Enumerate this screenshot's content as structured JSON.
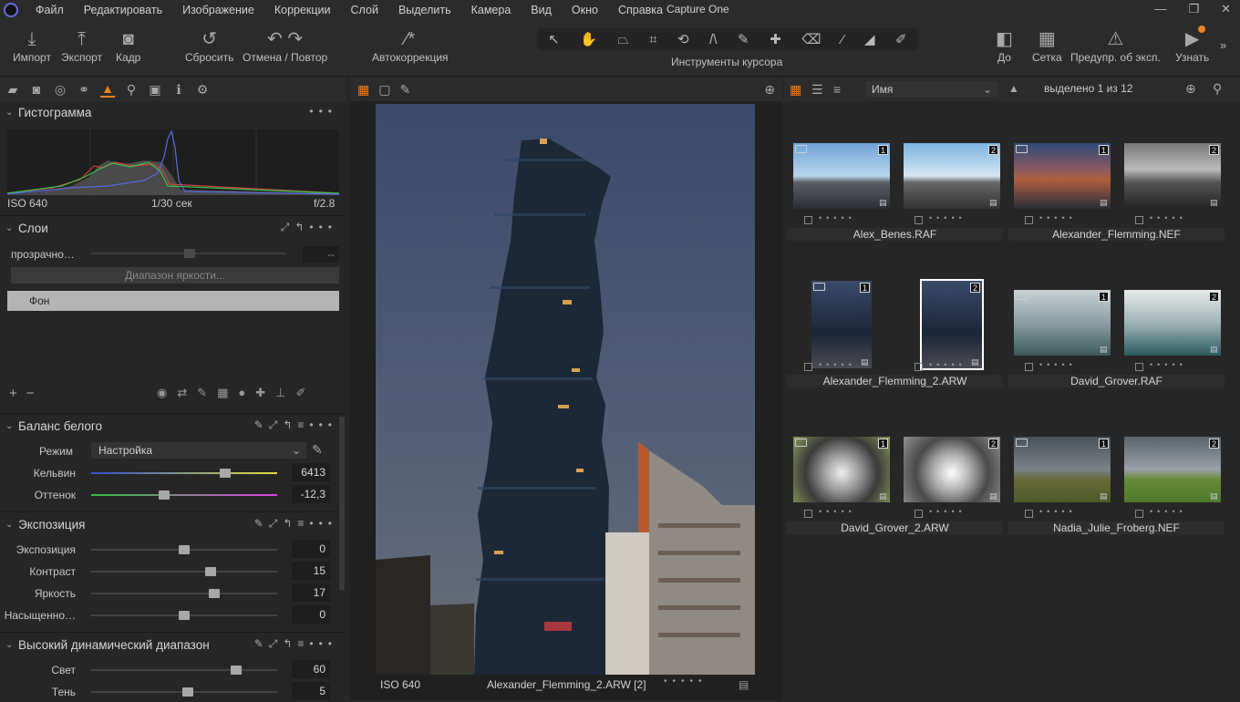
{
  "menu": {
    "items": [
      "Файл",
      "Редактировать",
      "Изображение",
      "Коррекции",
      "Слой",
      "Выделить",
      "Камера",
      "Вид",
      "Окно",
      "Справка"
    ],
    "app_title": "Capture One"
  },
  "toolbar": {
    "import": "Импорт",
    "export": "Экспорт",
    "crop": "Кадр",
    "reset": "Сбросить",
    "undo_redo": "Отмена / Повтор",
    "autocorrect": "Автокоррекция",
    "cursor_tools": "Инструменты курсора",
    "before": "До",
    "grid": "Сетка",
    "exposure_warning": "Предупр. об эксп.",
    "learn": "Узнать"
  },
  "histogram": {
    "title": "Гистограмма",
    "iso": "ISO 640",
    "shutter": "1/30 сек",
    "aperture": "f/2.8"
  },
  "layers": {
    "title": "Слои",
    "opacity_label": "прозрачно…",
    "opacity_value": "--",
    "luma_range": "Диапазон яркости...",
    "background_layer": "Фон"
  },
  "white_balance": {
    "title": "Баланс белого",
    "mode_label": "Режим",
    "mode_value": "Настройка",
    "kelvin_label": "Кельвин",
    "kelvin_value": "6413",
    "tint_label": "Оттенок",
    "tint_value": "-12,3",
    "kelvin_pos": 0.72,
    "tint_pos": 0.39
  },
  "exposure": {
    "title": "Экспозиция",
    "rows": [
      {
        "label": "Экспозиция",
        "value": "0",
        "pos": 0.5
      },
      {
        "label": "Контраст",
        "value": "15",
        "pos": 0.64
      },
      {
        "label": "Яркость",
        "value": "17",
        "pos": 0.66
      },
      {
        "label": "Насыщенно…",
        "value": "0",
        "pos": 0.5
      }
    ]
  },
  "hdr": {
    "title": "Высокий динамический диапазон",
    "rows": [
      {
        "label": "Свет",
        "value": "60",
        "pos": 0.78
      },
      {
        "label": "Тень",
        "value": "5",
        "pos": 0.52
      }
    ]
  },
  "viewer": {
    "iso": "ISO 640",
    "filename": "Alexander_Flemming_2.ARW [2]"
  },
  "browser": {
    "sort": "Имя",
    "selection": "выделено 1 из 12",
    "groups": [
      {
        "name": "Alex_Benes.RAF"
      },
      {
        "name": "Alexander_Flemming.NEF"
      },
      {
        "name": "Alexander_Flemming_2.ARW"
      },
      {
        "name": "David_Grover.RAF"
      },
      {
        "name": "David_Grover_2.ARW"
      },
      {
        "name": "Nadia_Julie_Froberg.NEF"
      }
    ],
    "badges": [
      "1",
      "2"
    ]
  },
  "colors": {
    "accent": "#f08020",
    "panel": "#262626"
  }
}
